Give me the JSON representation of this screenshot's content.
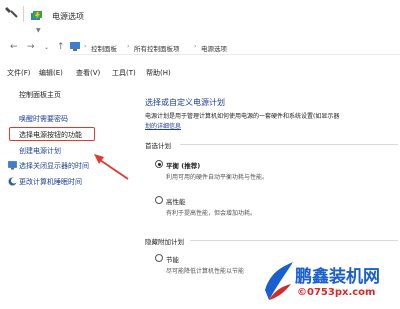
{
  "window": {
    "title": "电源选项"
  },
  "nav_icons": {
    "back": "back-arrow-icon",
    "forward": "forward-arrow-icon",
    "recent": "chevron-down-icon",
    "up": "up-arrow-icon"
  },
  "breadcrumbs": [
    "控制面板",
    "所有控制面板项",
    "电源选项"
  ],
  "menu": [
    "文件(F)",
    "编辑(E)",
    "查看(V)",
    "工具(T)",
    "帮助(H)"
  ],
  "sidebar": {
    "home": "控制面板主页",
    "items": [
      {
        "label": "唤醒时需要密码",
        "icon": ""
      },
      {
        "label": "选择电源按钮的功能",
        "icon": ""
      },
      {
        "label": "创建电源计划",
        "icon": ""
      },
      {
        "label": "选择关闭显示器的时间",
        "icon": "monitor-icon"
      },
      {
        "label": "更改计算机睡眠时间",
        "icon": "sleep-moon-icon"
      }
    ]
  },
  "main": {
    "heading": "选择或自定义电源计划",
    "description": "电源计划是用于管理计算机如何使用电源的一套硬件和系统设置(如显示器",
    "description_link": "划的详细信息",
    "preferred_section": "首选计划",
    "hidden_section": "隐藏附加计划",
    "plans": [
      {
        "name": "平衡 (推荐)",
        "desc": "利用可用的硬件自动平衡功耗与性能。",
        "selected": true
      },
      {
        "name": "高性能",
        "desc": "有利于提高性能，但会增加功耗。",
        "selected": false
      },
      {
        "name": "节能",
        "desc": "尽可能降低计算机性能以节能",
        "selected": false
      }
    ]
  },
  "watermark": {
    "title": "鹏鑫装机网",
    "url": "©0753px.com"
  },
  "colors": {
    "link": "#1e3f9a",
    "highlight": "#e03a30",
    "watermark_blue": "#1a5fd0",
    "watermark_red": "#d42a2a"
  }
}
